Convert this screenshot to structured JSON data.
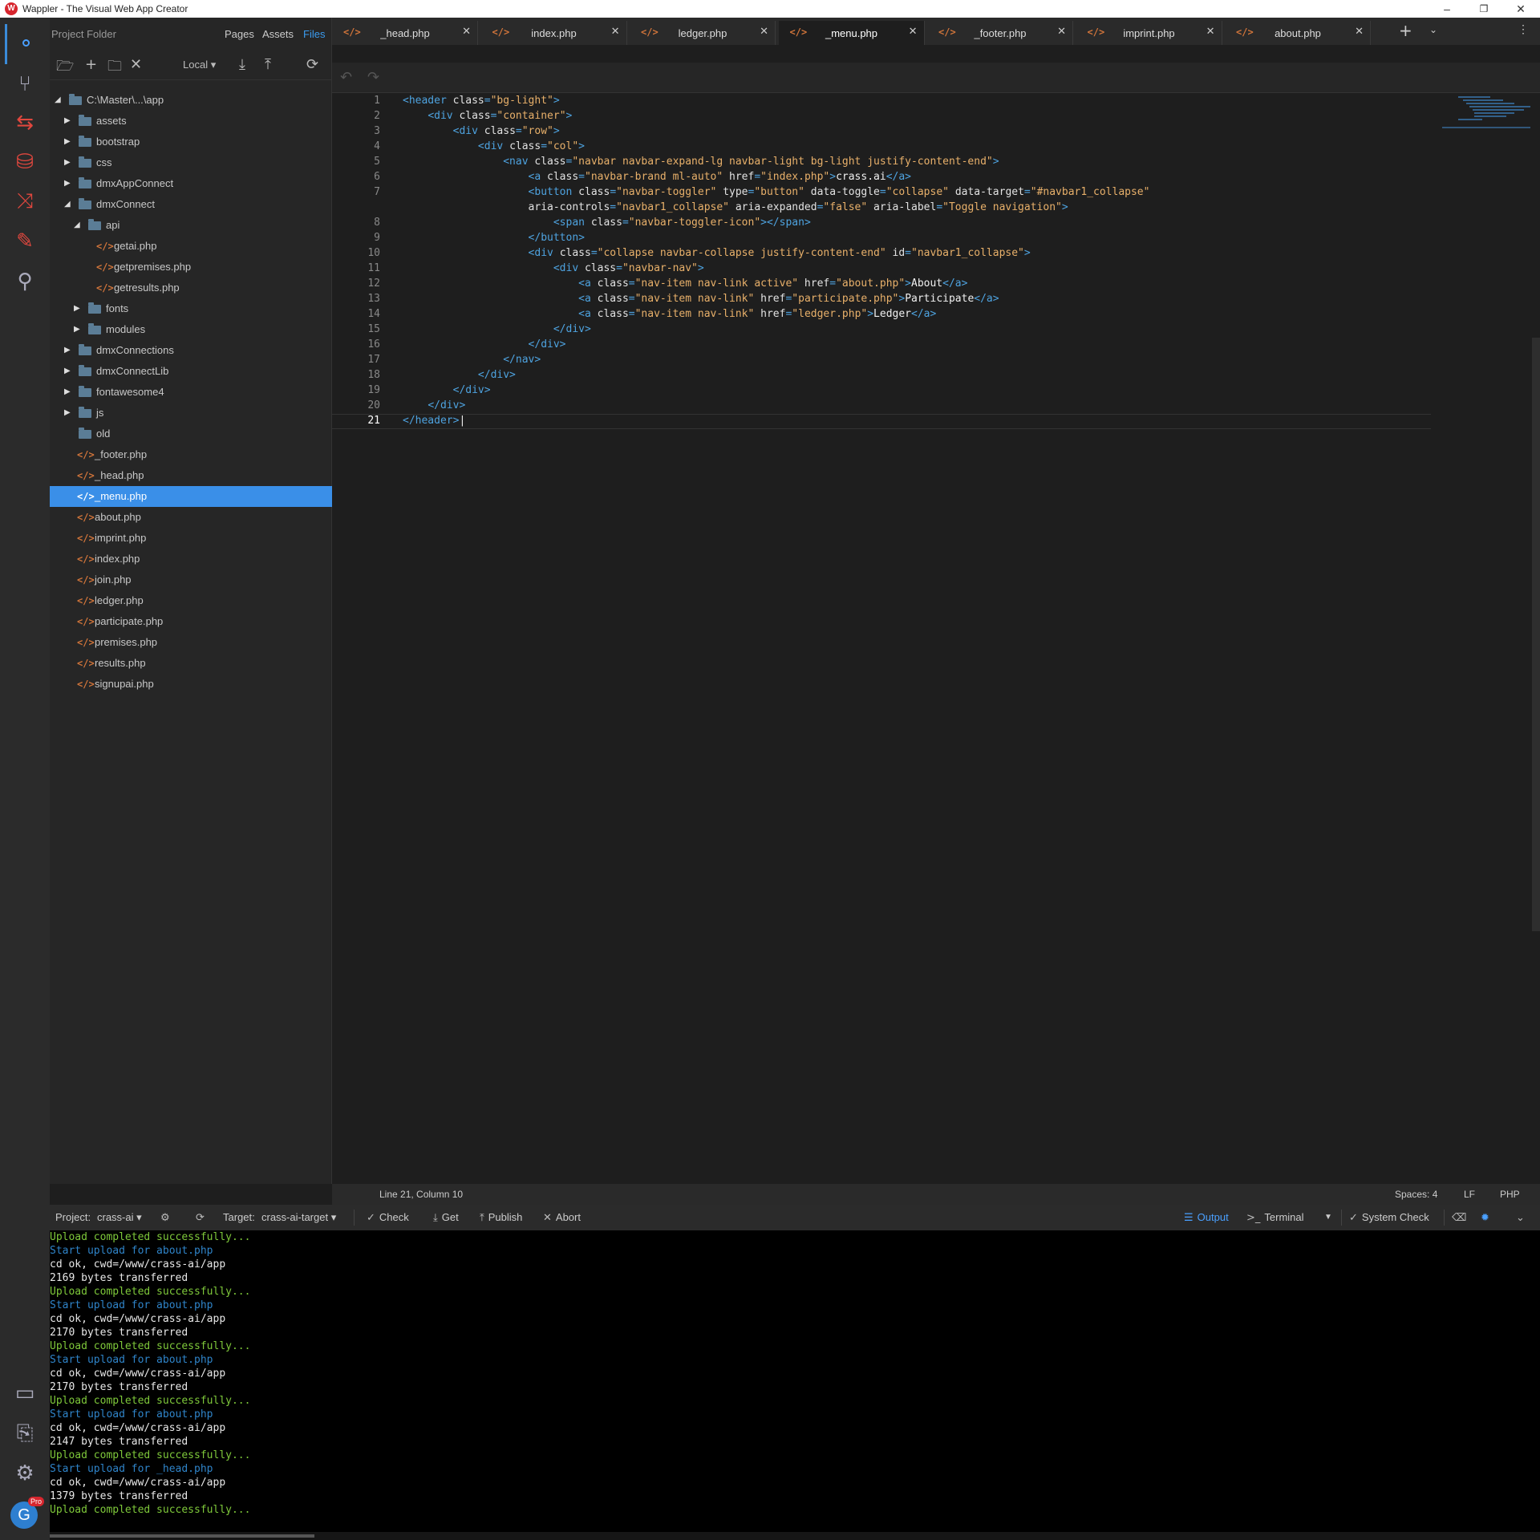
{
  "window": {
    "title": "Wappler - The Visual Web App Creator",
    "logo_letter": "W"
  },
  "activity": [
    {
      "name": "structure-icon",
      "glyph": "⚬"
    },
    {
      "name": "git-icon",
      "glyph": "⑂"
    },
    {
      "name": "routes-icon",
      "glyph": "⇆"
    },
    {
      "name": "database-icon",
      "glyph": "⛁"
    },
    {
      "name": "share-icon",
      "glyph": "⤨"
    },
    {
      "name": "design-icon",
      "glyph": "✎"
    },
    {
      "name": "search-icon",
      "glyph": "⚲"
    }
  ],
  "activity_bottom": [
    {
      "name": "server-icon",
      "glyph": "▭"
    },
    {
      "name": "resources-icon",
      "glyph": "⎘"
    },
    {
      "name": "settings-gear-icon",
      "glyph": "⚙"
    }
  ],
  "user": {
    "initial": "G",
    "badge": "Pro"
  },
  "panel": {
    "title": "Project Folder",
    "tabs": [
      "Pages",
      "Assets",
      "Files"
    ],
    "location": "Local ▾"
  },
  "tree": [
    {
      "label": "C:\\Master\\...\\app",
      "type": "folder",
      "level": 0,
      "caret": "open"
    },
    {
      "label": "assets",
      "type": "folder",
      "level": 1,
      "caret": "closed"
    },
    {
      "label": "bootstrap",
      "type": "folder",
      "level": 1,
      "caret": "closed"
    },
    {
      "label": "css",
      "type": "folder",
      "level": 1,
      "caret": "closed"
    },
    {
      "label": "dmxAppConnect",
      "type": "folder",
      "level": 1,
      "caret": "closed"
    },
    {
      "label": "dmxConnect",
      "type": "folder",
      "level": 1,
      "caret": "open"
    },
    {
      "label": "api",
      "type": "folder",
      "level": 2,
      "caret": "open"
    },
    {
      "label": "getai.php",
      "type": "file",
      "level": 3
    },
    {
      "label": "getpremises.php",
      "type": "file",
      "level": 3
    },
    {
      "label": "getresults.php",
      "type": "file",
      "level": 3
    },
    {
      "label": "fonts",
      "type": "folder",
      "level": 2,
      "caret": "closed"
    },
    {
      "label": "modules",
      "type": "folder",
      "level": 2,
      "caret": "closed"
    },
    {
      "label": "dmxConnections",
      "type": "folder",
      "level": 1,
      "caret": "closed"
    },
    {
      "label": "dmxConnectLib",
      "type": "folder",
      "level": 1,
      "caret": "closed"
    },
    {
      "label": "fontawesome4",
      "type": "folder",
      "level": 1,
      "caret": "closed"
    },
    {
      "label": "js",
      "type": "folder",
      "level": 1,
      "caret": "closed"
    },
    {
      "label": "old",
      "type": "folder",
      "level": 1,
      "caret": "none"
    },
    {
      "label": "_footer.php",
      "type": "file",
      "level": 1
    },
    {
      "label": "_head.php",
      "type": "file",
      "level": 1
    },
    {
      "label": "_menu.php",
      "type": "file",
      "level": 1,
      "selected": true
    },
    {
      "label": "about.php",
      "type": "file",
      "level": 1
    },
    {
      "label": "imprint.php",
      "type": "file",
      "level": 1
    },
    {
      "label": "index.php",
      "type": "file",
      "level": 1
    },
    {
      "label": "join.php",
      "type": "file",
      "level": 1
    },
    {
      "label": "ledger.php",
      "type": "file",
      "level": 1
    },
    {
      "label": "participate.php",
      "type": "file",
      "level": 1
    },
    {
      "label": "premises.php",
      "type": "file",
      "level": 1
    },
    {
      "label": "results.php",
      "type": "file",
      "level": 1
    },
    {
      "label": "signupai.php",
      "type": "file",
      "level": 1
    }
  ],
  "tabs": [
    {
      "label": "_head.php",
      "active": false
    },
    {
      "label": "index.php",
      "active": false
    },
    {
      "label": "ledger.php",
      "active": false
    },
    {
      "label": "_menu.php",
      "active": true
    },
    {
      "label": "_footer.php",
      "active": false
    },
    {
      "label": "imprint.php",
      "active": false
    },
    {
      "label": "about.php",
      "active": false
    }
  ],
  "code_line_numbers": [
    "1",
    "2",
    "3",
    "4",
    "5",
    "6",
    "7",
    "",
    "8",
    "9",
    "10",
    "11",
    "12",
    "13",
    "14",
    "15",
    "16",
    "17",
    "18",
    "19",
    "20",
    "21"
  ],
  "code": [
    [
      [
        "tag",
        "<header "
      ],
      [
        "attr",
        "class"
      ],
      [
        "tag",
        "="
      ],
      [
        "str",
        "\"bg-light\""
      ],
      [
        "tag",
        ">"
      ]
    ],
    [
      [
        "txt",
        "    "
      ],
      [
        "tag",
        "<div "
      ],
      [
        "attr",
        "class"
      ],
      [
        "tag",
        "="
      ],
      [
        "str",
        "\"container\""
      ],
      [
        "tag",
        ">"
      ]
    ],
    [
      [
        "txt",
        "        "
      ],
      [
        "tag",
        "<div "
      ],
      [
        "attr",
        "class"
      ],
      [
        "tag",
        "="
      ],
      [
        "str",
        "\"row\""
      ],
      [
        "tag",
        ">"
      ]
    ],
    [
      [
        "txt",
        "            "
      ],
      [
        "tag",
        "<div "
      ],
      [
        "attr",
        "class"
      ],
      [
        "tag",
        "="
      ],
      [
        "str",
        "\"col\""
      ],
      [
        "tag",
        ">"
      ]
    ],
    [
      [
        "txt",
        "                "
      ],
      [
        "tag",
        "<nav "
      ],
      [
        "attr",
        "class"
      ],
      [
        "tag",
        "="
      ],
      [
        "str",
        "\"navbar navbar-expand-lg navbar-light bg-light justify-content-end\""
      ],
      [
        "tag",
        ">"
      ]
    ],
    [
      [
        "txt",
        "                    "
      ],
      [
        "tag",
        "<a "
      ],
      [
        "attr",
        "class"
      ],
      [
        "tag",
        "="
      ],
      [
        "str",
        "\"navbar-brand ml-auto\""
      ],
      [
        "attr",
        " href"
      ],
      [
        "tag",
        "="
      ],
      [
        "str",
        "\"index.php\""
      ],
      [
        "tag",
        ">"
      ],
      [
        "txt",
        "crass.ai"
      ],
      [
        "tag",
        "</a>"
      ]
    ],
    [
      [
        "txt",
        "                    "
      ],
      [
        "tag",
        "<button "
      ],
      [
        "attr",
        "class"
      ],
      [
        "tag",
        "="
      ],
      [
        "str",
        "\"navbar-toggler\""
      ],
      [
        "attr",
        " type"
      ],
      [
        "tag",
        "="
      ],
      [
        "str",
        "\"button\""
      ],
      [
        "attr",
        " data-toggle"
      ],
      [
        "tag",
        "="
      ],
      [
        "str",
        "\"collapse\""
      ],
      [
        "attr",
        " data-target"
      ],
      [
        "tag",
        "="
      ],
      [
        "str",
        "\"#navbar1_collapse\""
      ]
    ],
    [
      [
        "txt",
        "                    "
      ],
      [
        "attr",
        "aria-controls"
      ],
      [
        "tag",
        "="
      ],
      [
        "str",
        "\"navbar1_collapse\""
      ],
      [
        "attr",
        " aria-expanded"
      ],
      [
        "tag",
        "="
      ],
      [
        "str",
        "\"false\""
      ],
      [
        "attr",
        " aria-label"
      ],
      [
        "tag",
        "="
      ],
      [
        "str",
        "\"Toggle navigation\""
      ],
      [
        "tag",
        ">"
      ]
    ],
    [
      [
        "txt",
        "                        "
      ],
      [
        "tag",
        "<span "
      ],
      [
        "attr",
        "class"
      ],
      [
        "tag",
        "="
      ],
      [
        "str",
        "\"navbar-toggler-icon\""
      ],
      [
        "tag",
        "></span>"
      ]
    ],
    [
      [
        "txt",
        "                    "
      ],
      [
        "tag",
        "</button>"
      ]
    ],
    [
      [
        "txt",
        "                    "
      ],
      [
        "tag",
        "<div "
      ],
      [
        "attr",
        "class"
      ],
      [
        "tag",
        "="
      ],
      [
        "str",
        "\"collapse navbar-collapse justify-content-end\""
      ],
      [
        "attr",
        " id"
      ],
      [
        "tag",
        "="
      ],
      [
        "str",
        "\"navbar1_collapse\""
      ],
      [
        "tag",
        ">"
      ]
    ],
    [
      [
        "txt",
        "                        "
      ],
      [
        "tag",
        "<div "
      ],
      [
        "attr",
        "class"
      ],
      [
        "tag",
        "="
      ],
      [
        "str",
        "\"navbar-nav\""
      ],
      [
        "tag",
        ">"
      ]
    ],
    [
      [
        "txt",
        "                            "
      ],
      [
        "tag",
        "<a "
      ],
      [
        "attr",
        "class"
      ],
      [
        "tag",
        "="
      ],
      [
        "str",
        "\"nav-item nav-link active\""
      ],
      [
        "attr",
        " href"
      ],
      [
        "tag",
        "="
      ],
      [
        "str",
        "\"about.php\""
      ],
      [
        "tag",
        ">"
      ],
      [
        "txt",
        "About"
      ],
      [
        "tag",
        "</a>"
      ]
    ],
    [
      [
        "txt",
        "                            "
      ],
      [
        "tag",
        "<a "
      ],
      [
        "attr",
        "class"
      ],
      [
        "tag",
        "="
      ],
      [
        "str",
        "\"nav-item nav-link\""
      ],
      [
        "attr",
        " href"
      ],
      [
        "tag",
        "="
      ],
      [
        "str",
        "\"participate.php\""
      ],
      [
        "tag",
        ">"
      ],
      [
        "txt",
        "Participate"
      ],
      [
        "tag",
        "</a>"
      ]
    ],
    [
      [
        "txt",
        "                            "
      ],
      [
        "tag",
        "<a "
      ],
      [
        "attr",
        "class"
      ],
      [
        "tag",
        "="
      ],
      [
        "str",
        "\"nav-item nav-link\""
      ],
      [
        "attr",
        " href"
      ],
      [
        "tag",
        "="
      ],
      [
        "str",
        "\"ledger.php\""
      ],
      [
        "tag",
        ">"
      ],
      [
        "txt",
        "Ledger"
      ],
      [
        "tag",
        "</a>"
      ]
    ],
    [
      [
        "txt",
        "                        "
      ],
      [
        "tag",
        "</div>"
      ]
    ],
    [
      [
        "txt",
        "                    "
      ],
      [
        "tag",
        "</div>"
      ]
    ],
    [
      [
        "txt",
        "                "
      ],
      [
        "tag",
        "</nav>"
      ]
    ],
    [
      [
        "txt",
        "            "
      ],
      [
        "tag",
        "</div>"
      ]
    ],
    [
      [
        "txt",
        "        "
      ],
      [
        "tag",
        "</div>"
      ]
    ],
    [
      [
        "txt",
        "    "
      ],
      [
        "tag",
        "</div>"
      ]
    ],
    [
      [
        "tag",
        "</header>"
      ],
      [
        "txt",
        "|"
      ]
    ]
  ],
  "status": {
    "position": "Line 21, Column 10",
    "spaces": "Spaces: 4",
    "eol": "LF",
    "lang": "PHP"
  },
  "bottombar": {
    "project_label": "Project:",
    "project": "crass-ai ▾",
    "target_label": "Target:",
    "target": "crass-ai-target ▾",
    "check": "Check",
    "get": "Get",
    "publish": "Publish",
    "abort": "Abort",
    "output": "Output",
    "terminal": "Terminal",
    "system_check": "System Check"
  },
  "console": [
    {
      "text": "Upload completed successfully...",
      "kind": "green"
    },
    {
      "text": "Start upload for about.php",
      "kind": "blue"
    },
    {
      "text": "cd ok, cwd=/www/crass-ai/app",
      "kind": "white"
    },
    {
      "text": "2169 bytes transferred",
      "kind": "white"
    },
    {
      "text": "Upload completed successfully...",
      "kind": "green"
    },
    {
      "text": "Start upload for about.php",
      "kind": "blue"
    },
    {
      "text": "cd ok, cwd=/www/crass-ai/app",
      "kind": "white"
    },
    {
      "text": "2170 bytes transferred",
      "kind": "white"
    },
    {
      "text": "Upload completed successfully...",
      "kind": "green"
    },
    {
      "text": "Start upload for about.php",
      "kind": "blue"
    },
    {
      "text": "cd ok, cwd=/www/crass-ai/app",
      "kind": "white"
    },
    {
      "text": "2170 bytes transferred",
      "kind": "white"
    },
    {
      "text": "Upload completed successfully...",
      "kind": "green"
    },
    {
      "text": "Start upload for about.php",
      "kind": "blue"
    },
    {
      "text": "cd ok, cwd=/www/crass-ai/app",
      "kind": "white"
    },
    {
      "text": "2147 bytes transferred",
      "kind": "white"
    },
    {
      "text": "Upload completed successfully...",
      "kind": "green"
    },
    {
      "text": "Start upload for _head.php",
      "kind": "blue"
    },
    {
      "text": "cd ok, cwd=/www/crass-ai/app",
      "kind": "white"
    },
    {
      "text": "1379 bytes transferred",
      "kind": "white"
    },
    {
      "text": "Upload completed successfully...",
      "kind": "green"
    }
  ]
}
